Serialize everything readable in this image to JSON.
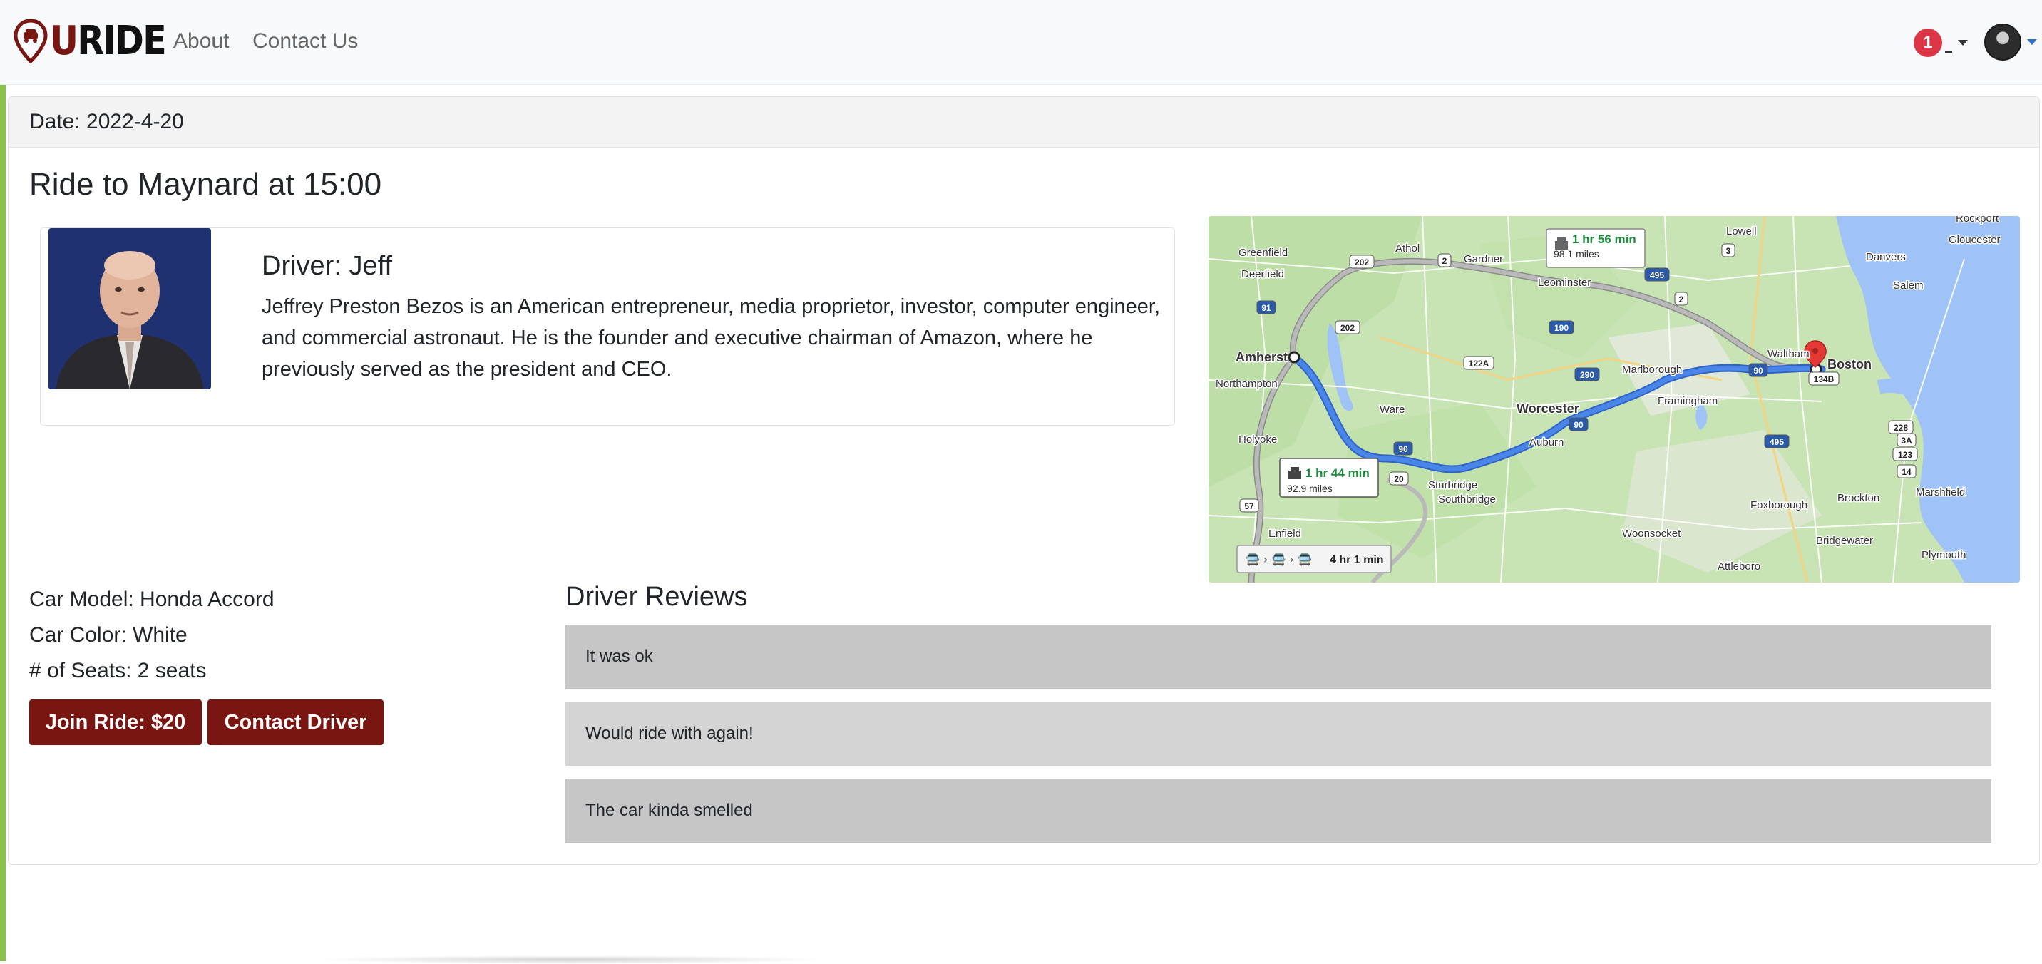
{
  "nav": {
    "brand_text": "URIDE",
    "about": "About",
    "contact": "Contact Us",
    "notification_count": "1",
    "avatar_label": "profile"
  },
  "ride": {
    "date_label": "Date: 2022-4-20",
    "title": "Ride to Maynard at 15:00"
  },
  "driver": {
    "name_label": "Driver: Jeff",
    "bio": "Jeffrey Preston Bezos is an American entrepreneur, media proprietor, investor, computer engineer, and commercial astronaut. He is the founder and executive chairman of Amazon, where he previously served as the president and CEO."
  },
  "car": {
    "model": "Car Model: Honda Accord",
    "color": "Car Color: White",
    "seats": "# of Seats: 2 seats"
  },
  "buttons": {
    "join": "Join Ride: $20",
    "contact": "Contact Driver"
  },
  "reviews": {
    "title": "Driver Reviews",
    "items": [
      "It was ok",
      "Would ride with again!",
      "The car kinda smelled"
    ]
  },
  "map": {
    "route_primary_time": "1 hr 44 min",
    "route_primary_distance": "92.9 miles",
    "route_alt_time": "1 hr 56 min",
    "route_alt_distance": "98.1 miles",
    "transit_time": "4 hr 1 min",
    "places": {
      "greenfield": "Greenfield",
      "deerfield": "Deerfield",
      "athol": "Athol",
      "gardner": "Gardner",
      "leominster": "Leominster",
      "lowell": "Lowell",
      "rockport": "Rockport",
      "gloucester": "Gloucester",
      "danvers": "Danvers",
      "salem": "Salem",
      "amherst": "Amherst",
      "northampton": "Northampton",
      "waltham": "Waltham",
      "boston": "Boston",
      "marlborough": "Marlborough",
      "framingham": "Framingham",
      "worcester": "Worcester",
      "ware": "Ware",
      "holyoke": "Holyoke",
      "auburn": "Auburn",
      "sturbridge": "Sturbridge",
      "southbridge": "Southbridge",
      "foxborough": "Foxborough",
      "brockton": "Brockton",
      "marshfield": "Marshfield",
      "enfield": "Enfield",
      "woonsocket": "Woonsocket",
      "bridgewater": "Bridgewater",
      "attleboro": "Attleboro",
      "plymouth": "Plymouth"
    },
    "shields": {
      "i91": "91",
      "r202a": "202",
      "r202b": "202",
      "r2a": "2",
      "r2b": "2",
      "r190": "190",
      "r122a": "122A",
      "r290": "290",
      "r495a": "495",
      "r495b": "495",
      "r3": "3",
      "r90a": "90",
      "r90b": "90",
      "r90c": "90",
      "r20": "20",
      "r57": "57",
      "r228": "228",
      "r123": "123",
      "r3a": "3A",
      "r14": "14",
      "r1348": "134B"
    },
    "colors": {
      "route_primary": "#4a86e8",
      "route_alt": "#a8a8a8",
      "water": "#9fc3f7",
      "land": "#c8e3b4"
    }
  }
}
